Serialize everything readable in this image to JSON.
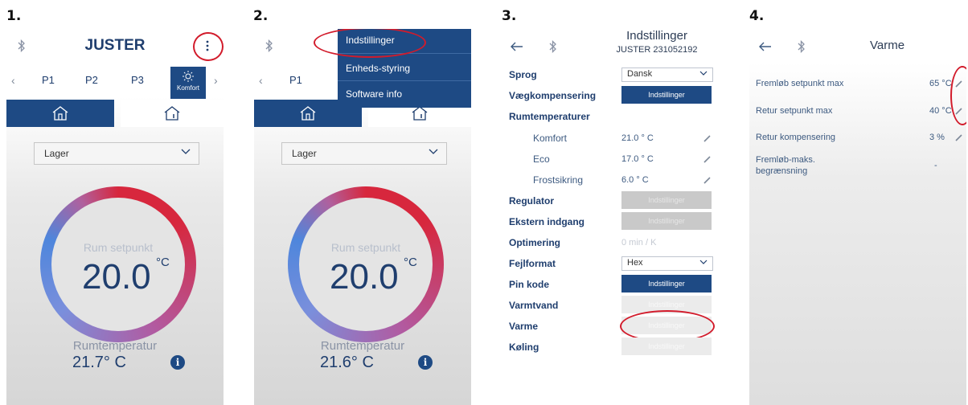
{
  "steps": [
    "1.",
    "2.",
    "3.",
    "4."
  ],
  "colors": {
    "brand_blue": "#1e4a84",
    "text_blue": "#1f3e6e",
    "highlight_red": "#d21b2b"
  },
  "screen1": {
    "title": "JUSTER",
    "presets": [
      "P1",
      "P2",
      "P3"
    ],
    "komfort_label": "Komfort",
    "mode_select": "Lager",
    "setpoint_label": "Rum setpunkt",
    "setpoint_value": "20.0",
    "setpoint_unit": "°C",
    "room_label": "Rumtemperatur",
    "room_value": "21.7° C",
    "info": "i"
  },
  "screen2": {
    "presets": [
      "P1"
    ],
    "menu": [
      "Indstillinger",
      "Enheds-styring",
      "Software info"
    ],
    "mode_select": "Lager",
    "setpoint_label": "Rum setpunkt",
    "setpoint_value": "20.0",
    "setpoint_unit": "°C",
    "room_label": "Rumtemperatur",
    "room_value": "21.6° C",
    "info": "i"
  },
  "screen3": {
    "title": "Indstillinger",
    "subtitle": "JUSTER 231052192",
    "sprog_label": "Sprog",
    "sprog_value": "Dansk",
    "vaeg_label": "Vægkompensering",
    "btn_label": "Indstillinger",
    "rum_label": "Rumtemperaturer",
    "komfort_label": "Komfort",
    "komfort_value": "21.0 ° C",
    "eco_label": "Eco",
    "eco_value": "17.0 ° C",
    "frost_label": "Frostsikring",
    "frost_value": "6.0 ° C",
    "regulator_label": "Regulator",
    "ekstern_label": "Ekstern indgang",
    "optimering_label": "Optimering",
    "optimering_value": "0 min / K",
    "fejl_label": "Fejlformat",
    "fejl_value": "Hex",
    "pin_label": "Pin kode",
    "varmtvand_label": "Varmtvand",
    "varme_label": "Varme",
    "koeling_label": "Køling"
  },
  "screen4": {
    "title": "Varme",
    "rows": [
      {
        "label": "Fremløb setpunkt max",
        "value": "65 °C"
      },
      {
        "label": "Retur setpunkt max",
        "value": "40 °C"
      },
      {
        "label": "Retur kompensering",
        "value": "3 %"
      },
      {
        "label": "Fremløb-maks.",
        "label2": "begrænsning",
        "value": "-"
      }
    ]
  }
}
